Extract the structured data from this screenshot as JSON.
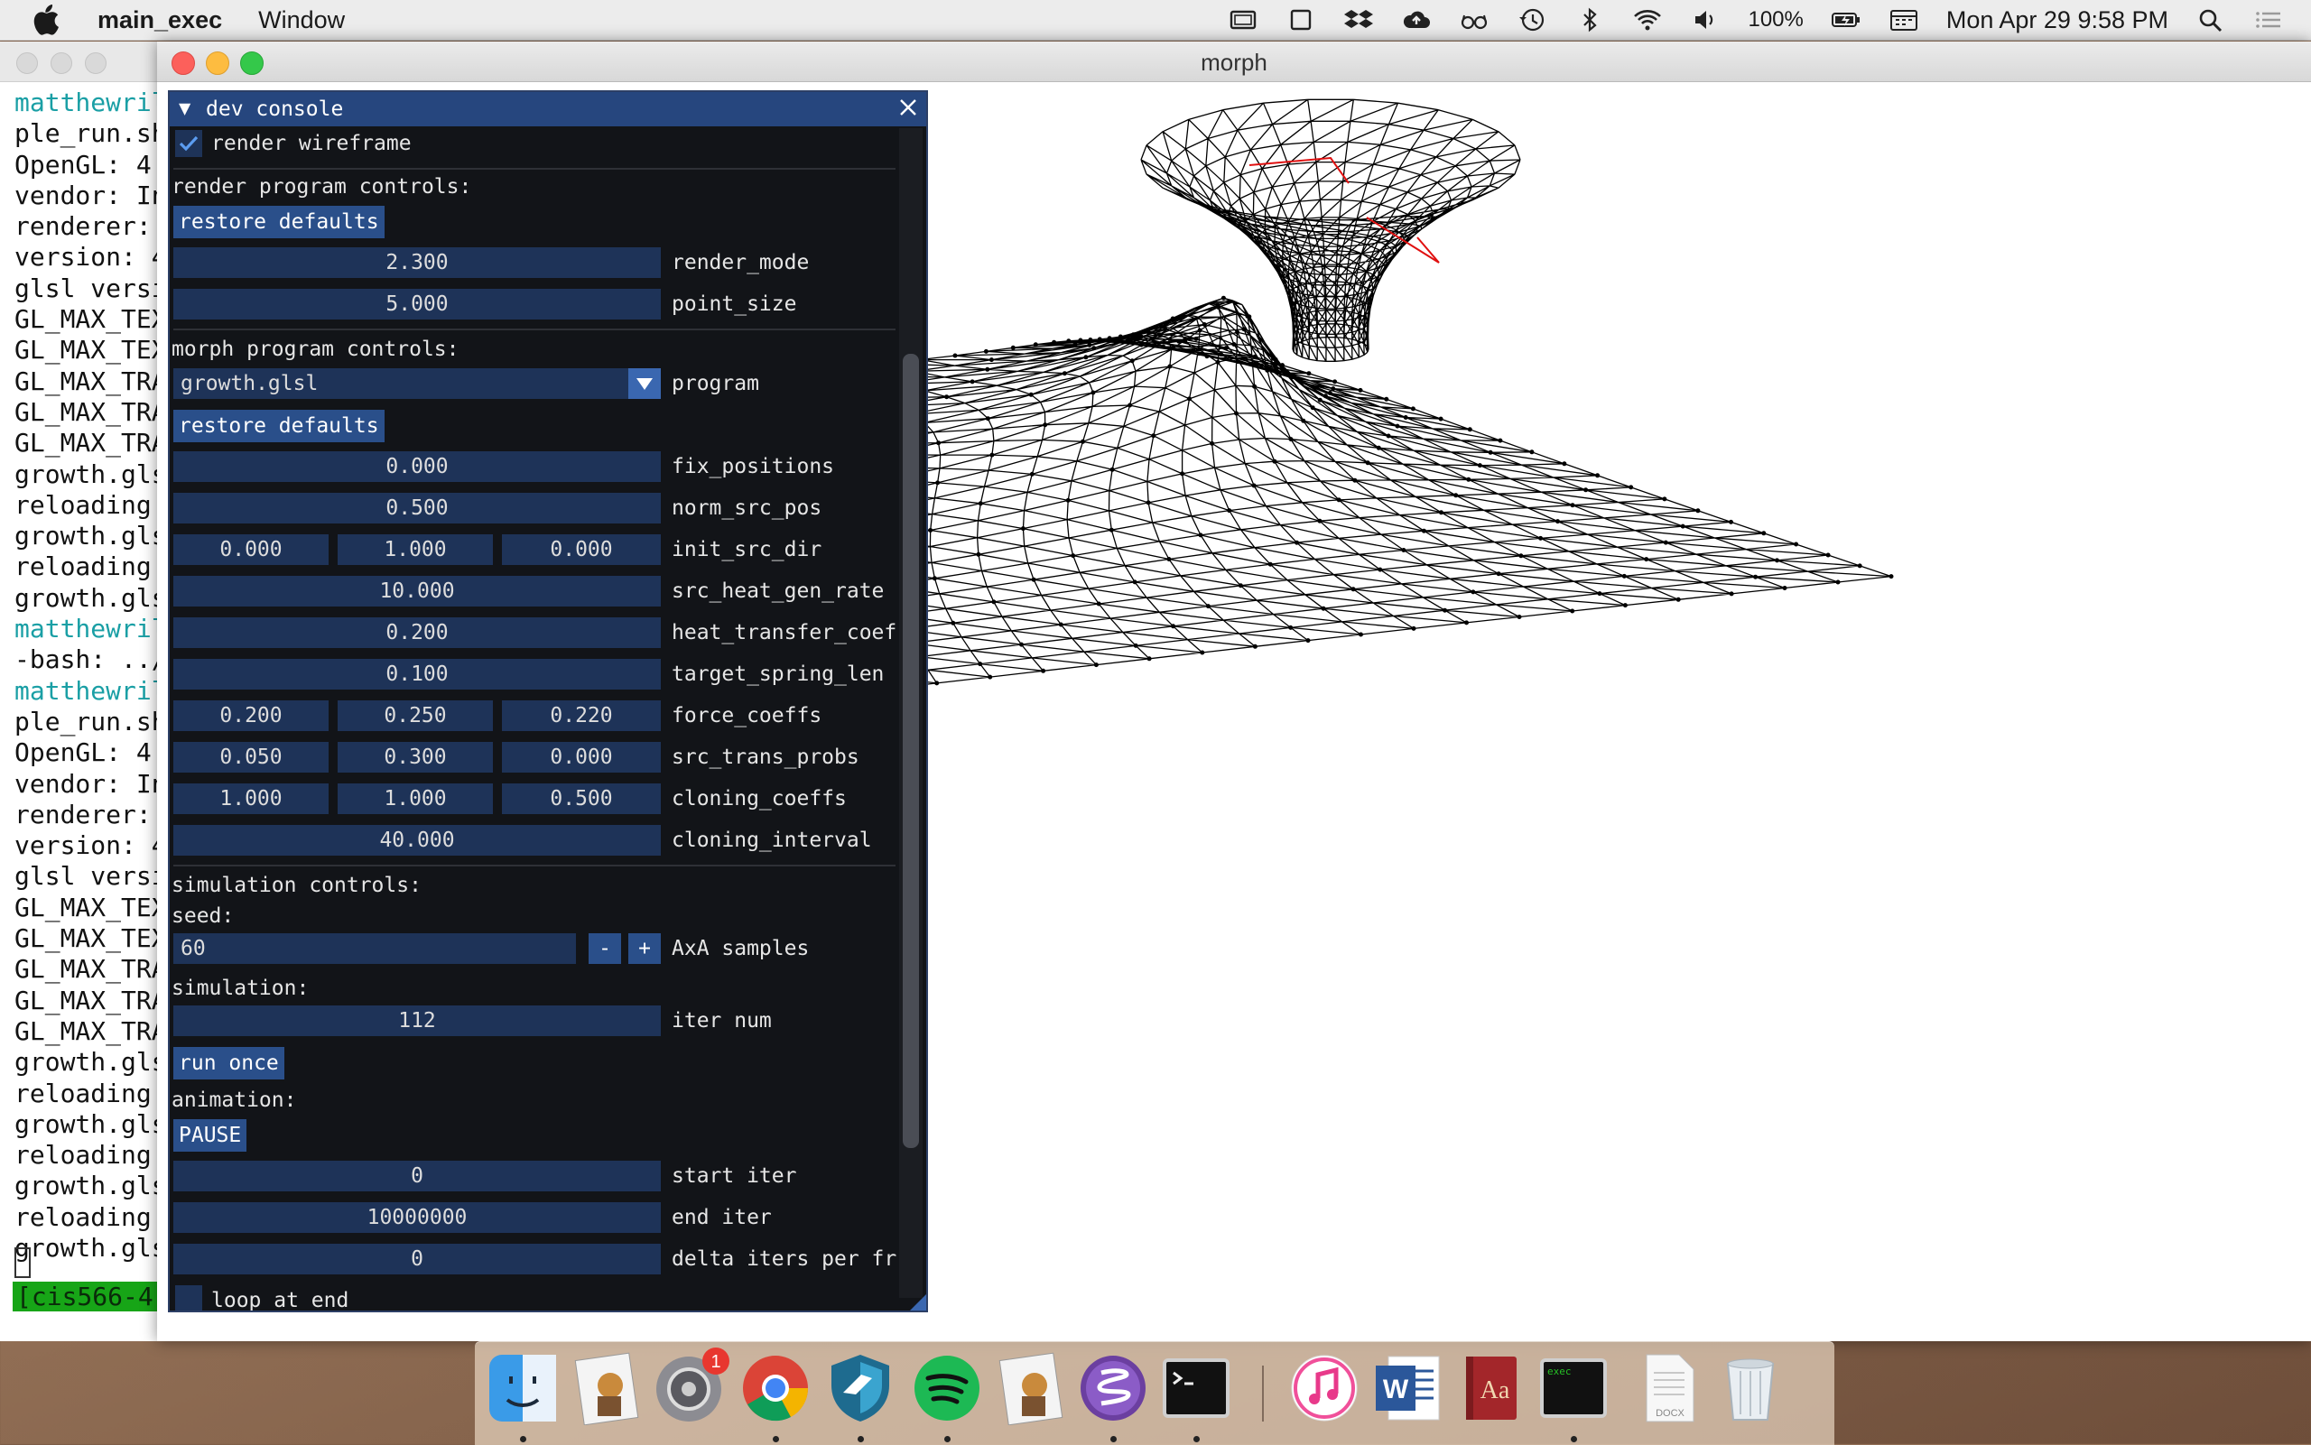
{
  "menubar": {
    "app_name": "main_exec",
    "menu_window": "Window",
    "battery": "100%",
    "clock": "Mon Apr 29  9:58 PM"
  },
  "terminal": {
    "lines": [
      {
        "text": "matthewril",
        "prompt": true
      },
      {
        "text": "ple_run.sh"
      },
      {
        "text": "OpenGL: 4."
      },
      {
        "text": "vendor: In"
      },
      {
        "text": "renderer: "
      },
      {
        "text": "version: 4"
      },
      {
        "text": "glsl versi"
      },
      {
        "text": "GL_MAX_TEX"
      },
      {
        "text": "GL_MAX_TEX"
      },
      {
        "text": "GL_MAX_TRA"
      },
      {
        "text": "GL_MAX_TRA"
      },
      {
        "text": "GL_MAX_TRA"
      },
      {
        "text": "growth.gls"
      },
      {
        "text": "reloading "
      },
      {
        "text": "growth.gls"
      },
      {
        "text": "reloading "
      },
      {
        "text": "growth.gls"
      },
      {
        "text": "matthewril",
        "prompt": true
      },
      {
        "text": "-bash: ../"
      },
      {
        "text": "matthewril",
        "prompt": true
      },
      {
        "text": "ple_run.sh"
      },
      {
        "text": "OpenGL: 4."
      },
      {
        "text": "vendor: In"
      },
      {
        "text": "renderer: "
      },
      {
        "text": "version: 4"
      },
      {
        "text": "glsl versi"
      },
      {
        "text": "GL_MAX_TEX"
      },
      {
        "text": "GL_MAX_TEX"
      },
      {
        "text": "GL_MAX_TRA"
      },
      {
        "text": "GL_MAX_TRA"
      },
      {
        "text": "GL_MAX_TRA"
      },
      {
        "text": "growth.gls"
      },
      {
        "text": "reloading "
      },
      {
        "text": "growth.gls"
      },
      {
        "text": "reloading "
      },
      {
        "text": "growth.gls"
      },
      {
        "text": "reloading "
      },
      {
        "text": "growth.gls"
      }
    ],
    "status": "[cis566-4]"
  },
  "morph_window": {
    "title": "morph"
  },
  "console": {
    "title": "dev console",
    "render_wireframe_label": "render wireframe",
    "render_section": "render program controls:",
    "restore_defaults": "restore defaults",
    "render_mode_value": "2.300",
    "render_mode_label": "render_mode",
    "point_size_value": "5.000",
    "point_size_label": "point_size",
    "morph_section": "morph program controls:",
    "program_value": "growth.glsl",
    "program_label": "program",
    "fix_positions_value": "0.000",
    "fix_positions_label": "fix_positions",
    "norm_src_pos_value": "0.500",
    "norm_src_pos_label": "norm_src_pos",
    "init_src_dir_values": [
      "0.000",
      "1.000",
      "0.000"
    ],
    "init_src_dir_label": "init_src_dir",
    "src_heat_gen_rate_value": "10.000",
    "src_heat_gen_rate_label": "src_heat_gen_rate",
    "heat_transfer_coef_value": "0.200",
    "heat_transfer_coef_label": "heat_transfer_coef",
    "target_spring_len_value": "0.100",
    "target_spring_len_label": "target_spring_len",
    "force_coeffs_values": [
      "0.200",
      "0.250",
      "0.220"
    ],
    "force_coeffs_label": "force_coeffs",
    "src_trans_probs_values": [
      "0.050",
      "0.300",
      "0.000"
    ],
    "src_trans_probs_label": "src_trans_probs",
    "cloning_coeffs_values": [
      "1.000",
      "1.000",
      "0.500"
    ],
    "cloning_coeffs_label": "cloning_coeffs",
    "cloning_interval_value": "40.000",
    "cloning_interval_label": "cloning_interval",
    "simulation_section": "simulation controls:",
    "seed_label": "seed:",
    "seed_value": "60",
    "minus": "-",
    "plus": "+",
    "samples_label": "AxA samples",
    "simulation_label": "simulation:",
    "iter_num_value": "112",
    "iter_num_label": "iter num",
    "run_once": "run once",
    "animation_label": "animation:",
    "pause": "PAUSE",
    "start_iter_value": "0",
    "start_iter_label": "start iter",
    "end_iter_value": "10000000",
    "end_iter_label": "end iter",
    "delta_iters_value": "0",
    "delta_iters_label": "delta iters per fr",
    "loop_at_end_label": "loop at end"
  },
  "dock": {
    "items": [
      "finder-icon",
      "preview-icon",
      "system-preferences-icon",
      "chrome-icon",
      "xcode-shield-icon",
      "spotify-icon",
      "preview-icon",
      "emacs-icon",
      "terminal-icon",
      "itunes-icon",
      "word-icon",
      "dictionary-icon",
      "exec-icon",
      "document-icon",
      "trash-icon"
    ],
    "badge_count": "1",
    "exec_label": "exec",
    "docx_label": "DOCX",
    "word_letter": "W",
    "dict_letters": "Aa"
  }
}
